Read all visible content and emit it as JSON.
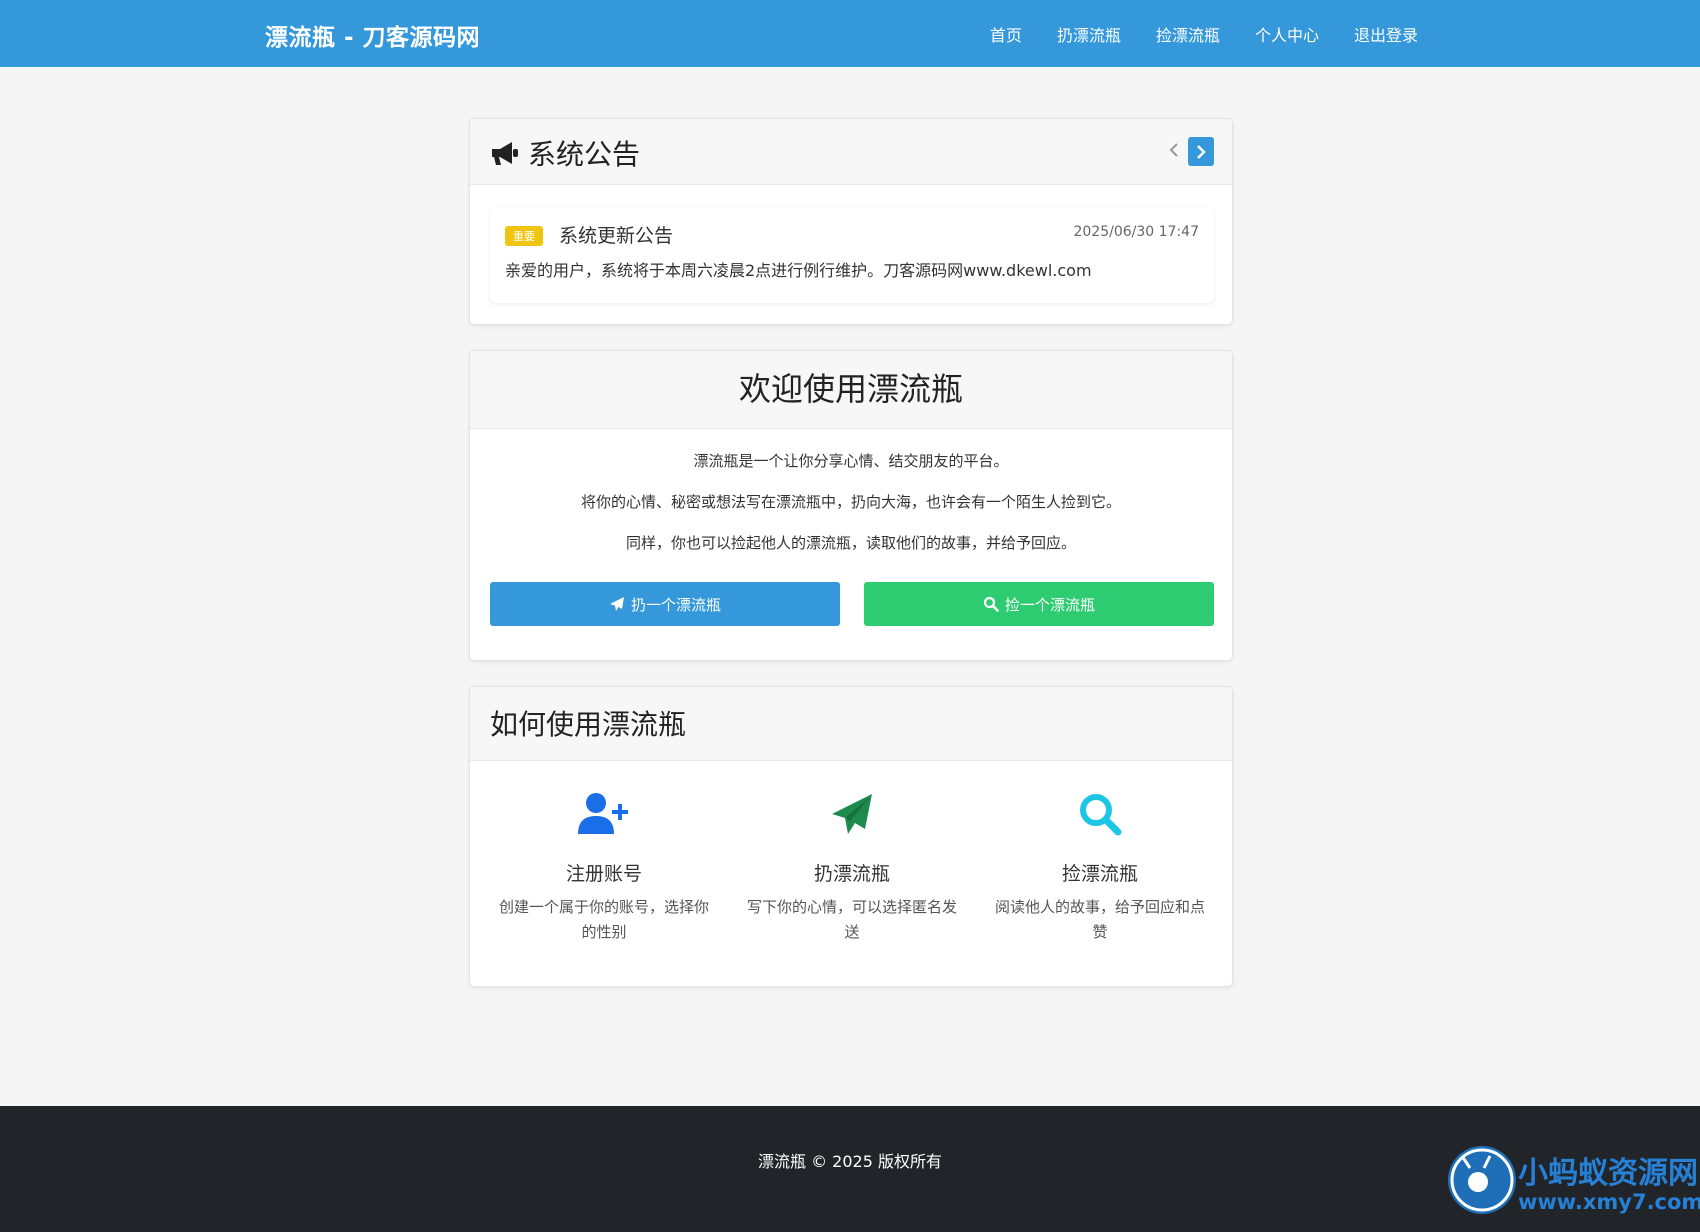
{
  "navbar": {
    "brand": "漂流瓶 - 刀客源码网",
    "links": [
      "首页",
      "扔漂流瓶",
      "捡漂流瓶",
      "个人中心",
      "退出登录"
    ]
  },
  "announcement": {
    "title": "系统公告",
    "prev_icon": "chevron-left-icon",
    "next_icon": "chevron-right-icon",
    "item": {
      "badge": "重要",
      "title": "系统更新公告",
      "date": "2025/06/30 17:47",
      "body": "亲爱的用户，系统将于本周六凌晨2点进行例行维护。刀客源码网www.dkewl.com"
    }
  },
  "welcome": {
    "title": "欢迎使用漂流瓶",
    "lines": [
      "漂流瓶是一个让你分享心情、结交朋友的平台。",
      "将你的心情、秘密或想法写在漂流瓶中，扔向大海，也许会有一个陌生人捡到它。",
      "同样，你也可以捡起他人的漂流瓶，读取他们的故事，并给予回应。"
    ],
    "throw_button": "扔一个漂流瓶",
    "pick_button": "捡一个漂流瓶"
  },
  "howto": {
    "title": "如何使用漂流瓶",
    "steps": [
      {
        "icon": "user-plus-icon",
        "title": "注册账号",
        "desc": "创建一个属于你的账号，选择你的性别"
      },
      {
        "icon": "paper-plane-icon",
        "title": "扔漂流瓶",
        "desc": "写下你的心情，可以选择匿名发送"
      },
      {
        "icon": "search-icon",
        "title": "捡漂流瓶",
        "desc": "阅读他人的故事，给予回应和点赞"
      }
    ]
  },
  "footer": {
    "text": "漂流瓶 © 2025 版权所有"
  },
  "watermark": {
    "name": "小蚂蚁资源网",
    "url": "www.xmy7.com"
  },
  "colors": {
    "primary": "#3498db",
    "success": "#2ecc71",
    "warning": "#f1c40f",
    "footer": "#212529",
    "step_user": "#1a6fe8",
    "step_plane": "#1e8a4e",
    "step_search": "#1ec6e6"
  }
}
